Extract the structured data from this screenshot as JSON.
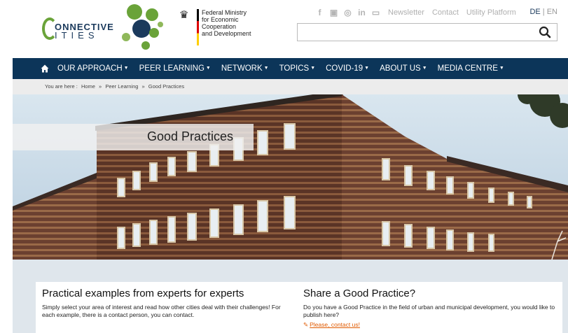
{
  "header": {
    "logo": {
      "line1": "ONNECTIVE",
      "line2": "ITIES"
    },
    "ministry": {
      "text": "Federal Ministry\nfor Economic Cooperation\nand Development"
    },
    "utility": {
      "icons": [
        "facebook-icon",
        "youtube-icon",
        "instagram-icon",
        "linkedin-icon",
        "calendar-icon"
      ],
      "links": [
        "Newsletter",
        "Contact",
        "Utility Platform"
      ]
    },
    "lang": {
      "de": "DE",
      "sep": "|",
      "en": "EN"
    },
    "search": {
      "placeholder": ""
    }
  },
  "nav": {
    "items": [
      "OUR APPROACH",
      "PEER LEARNING",
      "NETWORK",
      "TOPICS",
      "COVID-19",
      "ABOUT US",
      "MEDIA CENTRE"
    ]
  },
  "breadcrumb": {
    "prefix": "You are here :",
    "items": [
      "Home",
      "»",
      "Peer Learning",
      "»",
      "Good Practices"
    ]
  },
  "hero": {
    "title": "Good Practices"
  },
  "cards": {
    "left": {
      "title": "Practical examples from experts for experts",
      "text": "Simply select your area of interest and read how other cities deal with their challenges! For each example, there is a contact person, you can contact."
    },
    "right": {
      "title": "Share a Good Practice?",
      "text": "Do you have a Good Practice in the field of urban and municipal development, you would like to publish here?",
      "link": "Please, contact us!"
    }
  },
  "colors": {
    "nav_bg": "#0c3559",
    "brand_green": "#6aa339",
    "brand_blue": "#1b3a5c",
    "link_orange": "#e05a00"
  }
}
